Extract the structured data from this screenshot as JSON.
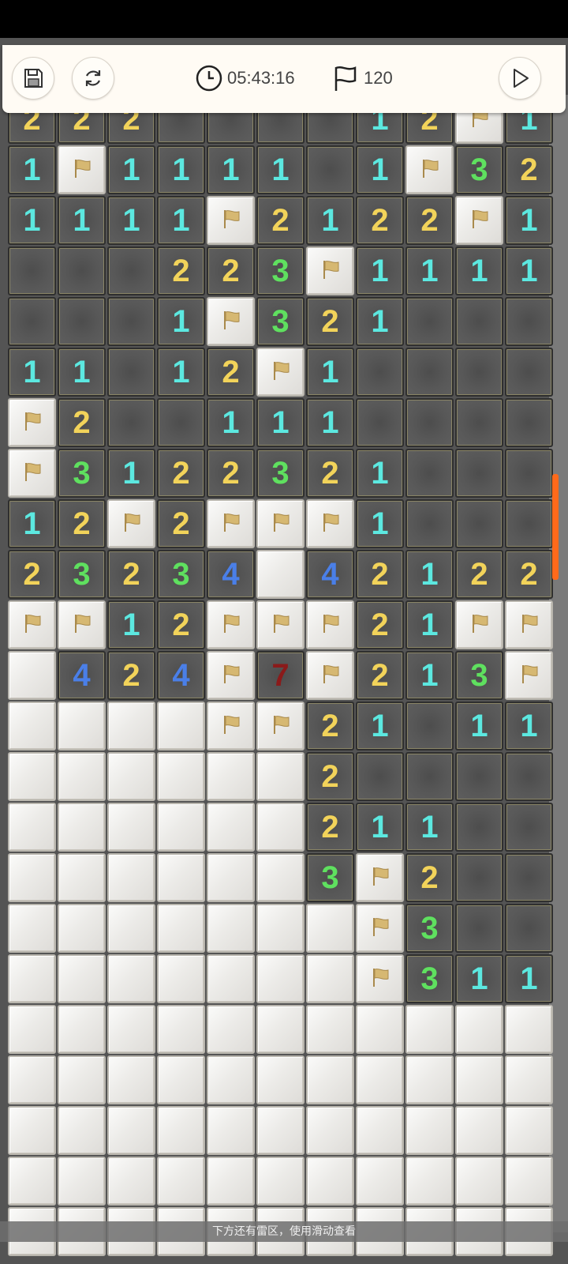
{
  "toolbar": {
    "save_icon": "save-icon",
    "restart_icon": "refresh-icon",
    "timer": "05:43:16",
    "flags": "120",
    "play_icon": "play-icon"
  },
  "colors": {
    "n1": "#5ce8e0",
    "n2": "#f2d35a",
    "n3": "#5fe05f",
    "n4": "#4a7fe8",
    "n7": "#8b1a1a",
    "flag": "#d6b872",
    "scroll": "#ff6a1a"
  },
  "board": {
    "rows": [
      [
        "2",
        "2",
        "2",
        "",
        "",
        "",
        "",
        "1",
        "2",
        "F",
        "1"
      ],
      [
        "1",
        "F",
        "1",
        "1",
        "1",
        "1",
        "",
        "1",
        "F",
        "3",
        "2"
      ],
      [
        "1",
        "1",
        "1",
        "1",
        "F",
        "2",
        "1",
        "2",
        "2",
        "F",
        "1"
      ],
      [
        "",
        "",
        "",
        "2",
        "2",
        "3",
        "F",
        "1",
        "1",
        "1",
        "1"
      ],
      [
        "",
        "",
        "",
        "1",
        "F",
        "3",
        "2",
        "1",
        "",
        "",
        ""
      ],
      [
        "1",
        "1",
        "",
        "1",
        "2",
        "F",
        "1",
        "",
        "",
        "",
        ""
      ],
      [
        "F",
        "2",
        "",
        "",
        "1",
        "1",
        "1",
        "",
        "",
        "",
        ""
      ],
      [
        "F",
        "3",
        "1",
        "2",
        "2",
        "3",
        "2",
        "1",
        "",
        "",
        ""
      ],
      [
        "1",
        "2",
        "F",
        "2",
        "F",
        "F",
        "F",
        "1",
        "",
        "",
        ""
      ],
      [
        "2",
        "3",
        "2",
        "3",
        "4",
        "H",
        "4",
        "2",
        "1",
        "2",
        "2"
      ],
      [
        "F",
        "F",
        "1",
        "2",
        "F",
        "F",
        "F",
        "2",
        "1",
        "F",
        "F"
      ],
      [
        "H",
        "4",
        "2",
        "4",
        "F",
        "7",
        "F",
        "2",
        "1",
        "3",
        "F"
      ],
      [
        "H",
        "H",
        "H",
        "H",
        "F",
        "F",
        "2",
        "1",
        "",
        "1",
        "1"
      ],
      [
        "H",
        "H",
        "H",
        "H",
        "H",
        "H",
        "2",
        "",
        "",
        "",
        ""
      ],
      [
        "H",
        "H",
        "H",
        "H",
        "H",
        "H",
        "2",
        "1",
        "1",
        "",
        ""
      ],
      [
        "H",
        "H",
        "H",
        "H",
        "H",
        "H",
        "3",
        "F",
        "2",
        "",
        ""
      ],
      [
        "H",
        "H",
        "H",
        "H",
        "H",
        "H",
        "H",
        "F",
        "3",
        "",
        ""
      ],
      [
        "H",
        "H",
        "H",
        "H",
        "H",
        "H",
        "H",
        "F",
        "3",
        "1",
        "1"
      ],
      [
        "H",
        "H",
        "H",
        "H",
        "H",
        "H",
        "H",
        "H",
        "H",
        "H",
        "H"
      ],
      [
        "H",
        "H",
        "H",
        "H",
        "H",
        "H",
        "H",
        "H",
        "H",
        "H",
        "H"
      ],
      [
        "H",
        "H",
        "H",
        "H",
        "H",
        "H",
        "H",
        "H",
        "H",
        "H",
        "H"
      ],
      [
        "H",
        "H",
        "H",
        "H",
        "H",
        "H",
        "H",
        "H",
        "H",
        "H",
        "H"
      ],
      [
        "H",
        "H",
        "H",
        "H",
        "H",
        "H",
        "H",
        "H",
        "H",
        "H",
        "H"
      ]
    ]
  },
  "hint": "下方还有雷区，使用滑动查看"
}
